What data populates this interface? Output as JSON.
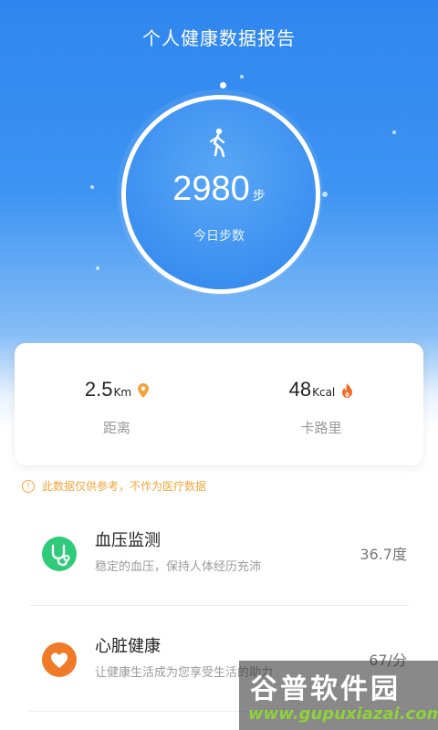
{
  "header": {
    "title": "个人健康数据报告"
  },
  "steps": {
    "value": "2980",
    "unit": "步",
    "label": "今日步数"
  },
  "stats": [
    {
      "value": "2.5",
      "unit": "Km",
      "label": "距离",
      "icon": "location-pin-icon",
      "icon_color": "#f2a33a"
    },
    {
      "value": "48",
      "unit": "Kcal",
      "label": "卡路里",
      "icon": "flame-icon",
      "icon_color": "#f06a2a"
    }
  ],
  "notice": {
    "text": "此数据仅供参考，不作为医疗数据",
    "color": "#f3a63a"
  },
  "items": [
    {
      "name": "血压监测",
      "desc": "稳定的血压，保持人体经历充沛",
      "value": "36.7度",
      "icon": "stethoscope-icon",
      "color": "#2fca7a"
    },
    {
      "name": "心脏健康",
      "desc": "让健康生活成为您享受生活的助力",
      "value": "67/分",
      "icon": "heart-icon",
      "color": "#f07a28"
    }
  ],
  "watermark": {
    "title": "谷普软件园",
    "url": "www.gupuxiazai.com"
  },
  "colors": {
    "primary": "#2f86ee"
  }
}
